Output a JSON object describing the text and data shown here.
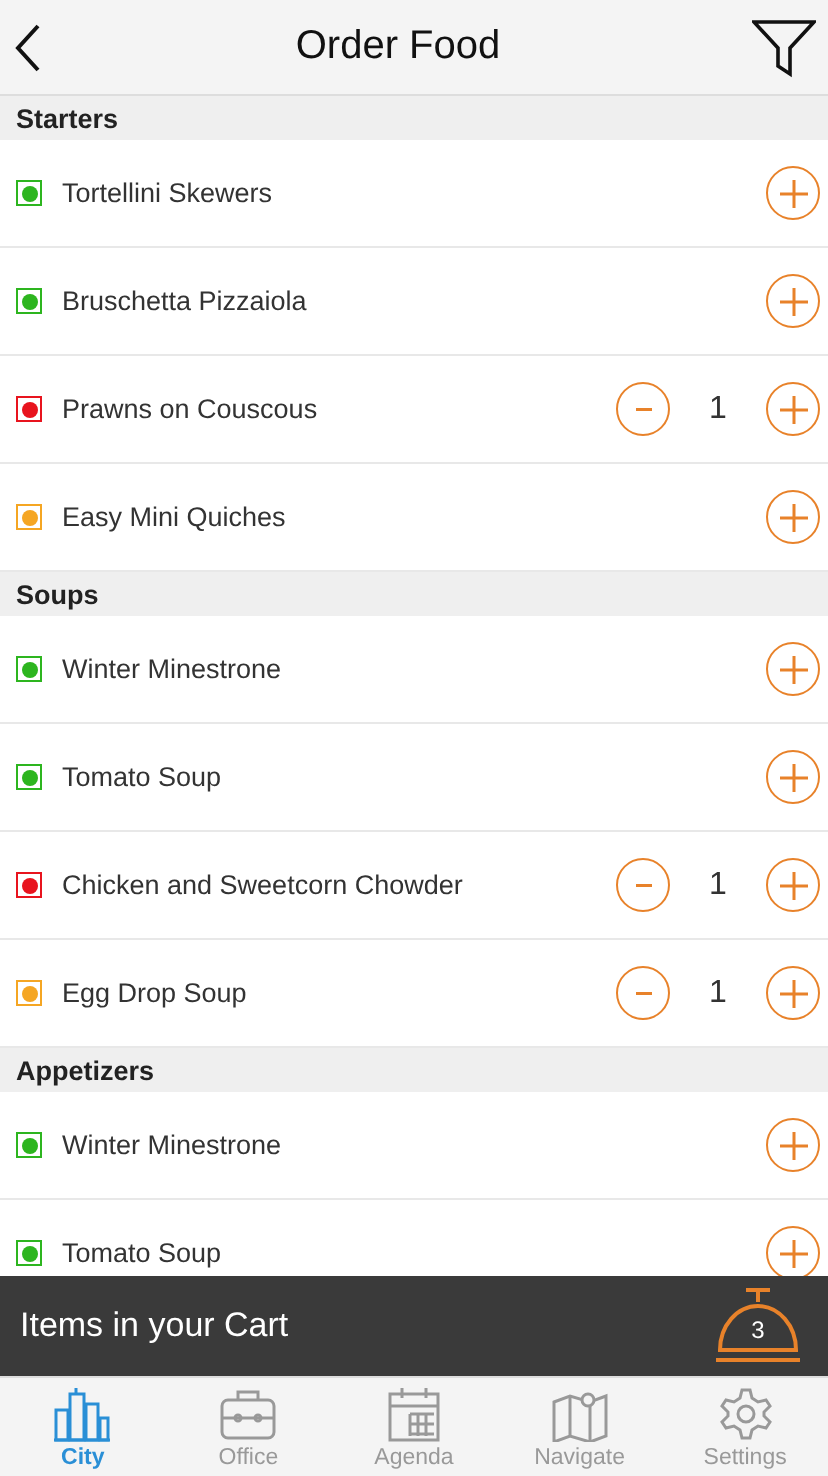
{
  "header": {
    "title": "Order Food"
  },
  "sections": [
    {
      "title": "Starters",
      "items": [
        {
          "name": "Tortellini Skewers",
          "color": "#2db51f"
        },
        {
          "name": "Bruschetta Pizzaiola",
          "color": "#2db51f"
        },
        {
          "name": "Prawns on Couscous",
          "color": "#e8141e",
          "quantity": "1"
        },
        {
          "name": "Easy Mini Quiches",
          "color": "#f5a623"
        }
      ]
    },
    {
      "title": "Soups",
      "items": [
        {
          "name": "Winter Minestrone",
          "color": "#2db51f"
        },
        {
          "name": "Tomato Soup",
          "color": "#2db51f"
        },
        {
          "name": "Chicken and Sweetcorn Chowder",
          "color": "#e8141e",
          "quantity": "1"
        },
        {
          "name": "Egg Drop Soup",
          "color": "#f5a623",
          "quantity": "1"
        }
      ]
    },
    {
      "title": "Appetizers",
      "items": [
        {
          "name": "Winter Minestrone",
          "color": "#2db51f"
        },
        {
          "name": "Tomato Soup",
          "color": "#2db51f"
        }
      ]
    }
  ],
  "cart": {
    "label": "Items in your Cart",
    "count": "3"
  },
  "tabs": [
    {
      "label": "City",
      "kind": "city",
      "selected": true
    },
    {
      "label": "Office",
      "kind": "office",
      "selected": false
    },
    {
      "label": "Agenda",
      "kind": "agenda",
      "selected": false
    },
    {
      "label": "Navigate",
      "kind": "navigate",
      "selected": false
    },
    {
      "label": "Settings",
      "kind": "settings",
      "selected": false
    }
  ]
}
